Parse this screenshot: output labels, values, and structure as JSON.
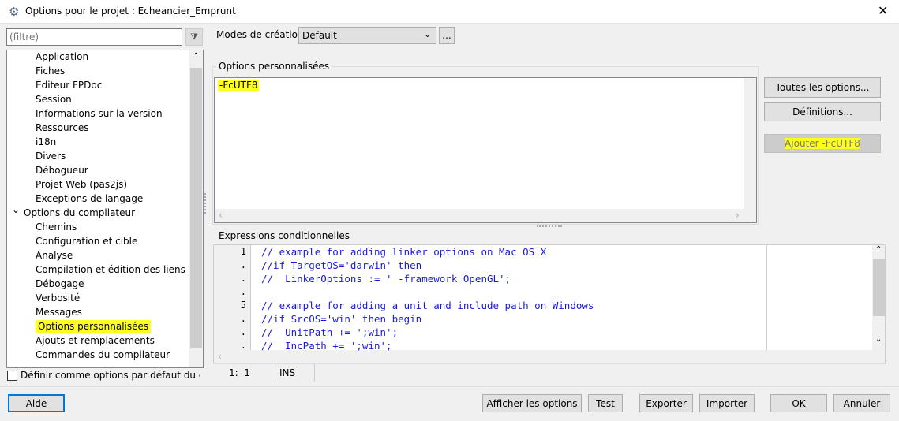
{
  "title": "Options pour le projet : Echeancier_Emprunt",
  "filter": {
    "placeholder": "(filtre)"
  },
  "tree": {
    "items": [
      {
        "label": "Application",
        "level": 1
      },
      {
        "label": "Fiches",
        "level": 1
      },
      {
        "label": "Éditeur FPDoc",
        "level": 1
      },
      {
        "label": "Session",
        "level": 1
      },
      {
        "label": "Informations sur la version",
        "level": 1
      },
      {
        "label": "Ressources",
        "level": 1
      },
      {
        "label": "i18n",
        "level": 1
      },
      {
        "label": "Divers",
        "level": 1
      },
      {
        "label": "Débogueur",
        "level": 1
      },
      {
        "label": "Projet Web (pas2js)",
        "level": 1
      },
      {
        "label": "Exceptions de langage",
        "level": 1
      },
      {
        "label": "Options du compilateur",
        "level": 0,
        "expanded": true
      },
      {
        "label": "Chemins",
        "level": 1
      },
      {
        "label": "Configuration et cible",
        "level": 1
      },
      {
        "label": "Analyse",
        "level": 1
      },
      {
        "label": "Compilation et édition des liens",
        "level": 1
      },
      {
        "label": "Débogage",
        "level": 1
      },
      {
        "label": "Verbosité",
        "level": 1
      },
      {
        "label": "Messages",
        "level": 1
      },
      {
        "label": "Options personnalisées",
        "level": 1,
        "selected": true
      },
      {
        "label": "Ajouts et remplacements",
        "level": 1
      },
      {
        "label": "Commandes du compilateur",
        "level": 1
      }
    ]
  },
  "default_checkbox": {
    "label": "Définir comme options par défaut du comp",
    "checked": false
  },
  "build_mode": {
    "label": "Modes de création",
    "value": "Default",
    "more": "..."
  },
  "custom_options": {
    "title": "Options personnalisées",
    "text": "-FcUTF8",
    "buttons": {
      "all": "Toutes les options...",
      "defines": "Définitions...",
      "add": "Ajouter -FcUTF8"
    }
  },
  "conditionals": {
    "title": "Expressions conditionnelles",
    "lines": [
      {
        "num": "1",
        "text": "// example for adding linker options on Mac OS X"
      },
      {
        "num": ".",
        "text": "//if TargetOS='darwin' then"
      },
      {
        "num": ".",
        "text": "//  LinkerOptions := ' -framework OpenGL';"
      },
      {
        "num": ".",
        "text": ""
      },
      {
        "num": "5",
        "text": "// example for adding a unit and include path on Windows"
      },
      {
        "num": ".",
        "text": "//if SrcOS='win' then begin"
      },
      {
        "num": ".",
        "text": "//  UnitPath += ';win';"
      },
      {
        "num": ".",
        "text": "//  IncPath += ';win';"
      }
    ]
  },
  "status": {
    "position": "1:  1",
    "mode": "INS"
  },
  "footer": {
    "help": "Aide",
    "show": "Afficher les options",
    "test": "Test",
    "export": "Exporter",
    "import": "Importer",
    "ok": "OK",
    "cancel": "Annuler"
  },
  "colors": {
    "highlight": "#ffff20",
    "code": "#1a1ad6"
  }
}
